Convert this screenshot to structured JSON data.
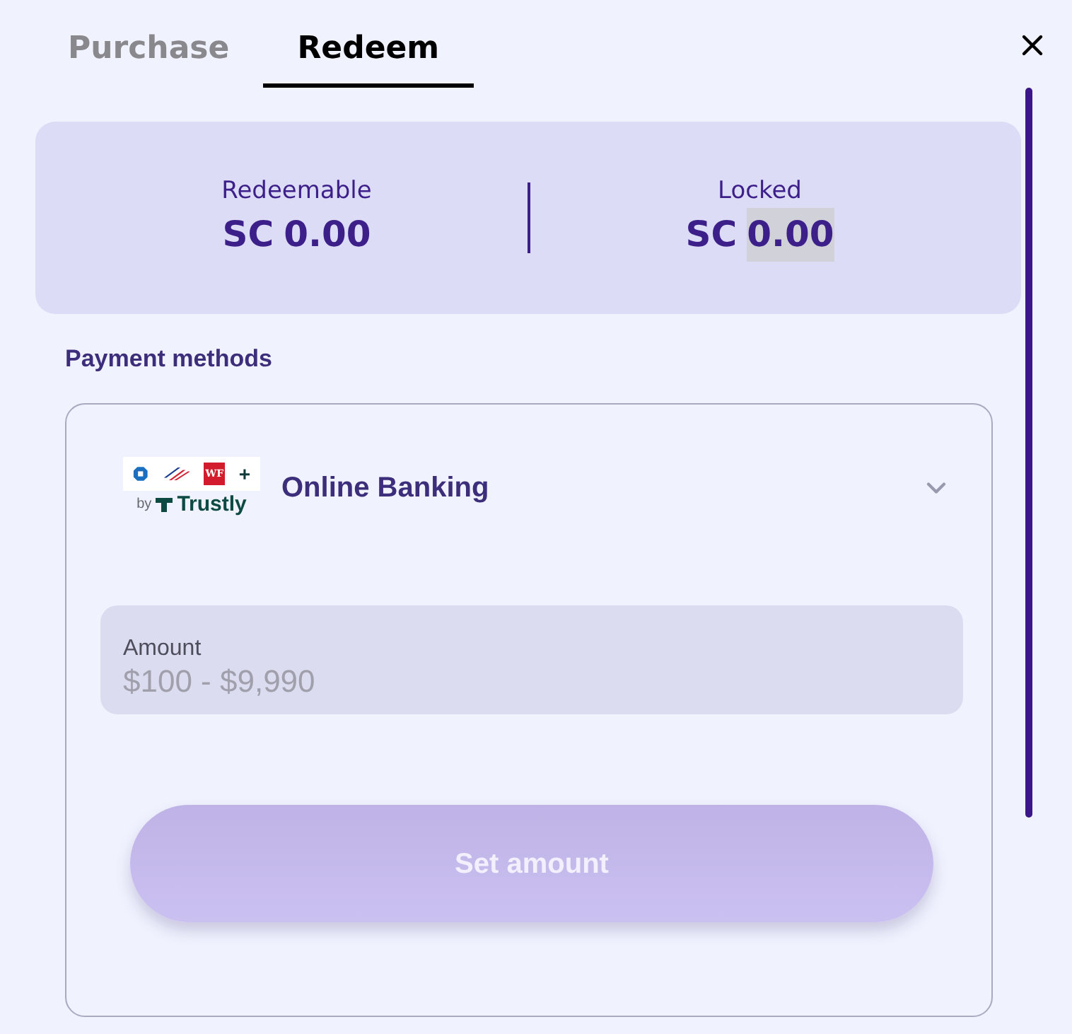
{
  "tabs": [
    {
      "label": "Purchase",
      "selected": false
    },
    {
      "label": "Redeem",
      "selected": true
    }
  ],
  "balances": [
    {
      "label": "Redeemable",
      "currency": "SC",
      "amount": "0.00",
      "highlighted": false
    },
    {
      "label": "Locked",
      "currency": "SC",
      "amount": "0.00",
      "highlighted": true
    }
  ],
  "payment_methods": {
    "title": "Payment methods",
    "method": {
      "name": "Online Banking",
      "logo": {
        "bank_mark": "WF",
        "plus": "+",
        "by": "by",
        "brand": "Trustly"
      }
    },
    "amount_field": {
      "label": "Amount",
      "placeholder": "$100 - $9,990"
    },
    "submit_button": {
      "label": "Set amount",
      "disabled": true
    }
  }
}
